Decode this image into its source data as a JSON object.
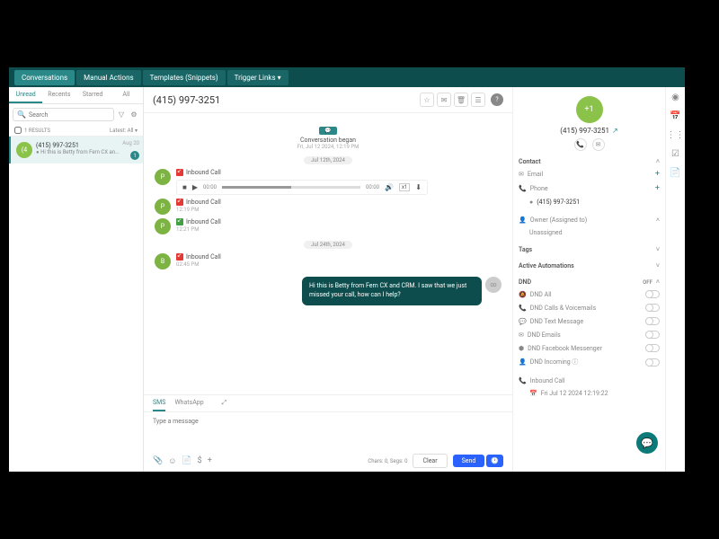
{
  "topnav": {
    "tabs": [
      "Conversations",
      "Manual Actions",
      "Templates (Snippets)",
      "Trigger Links ▾"
    ],
    "active": 0
  },
  "subtabs": {
    "items": [
      "Unread",
      "Recents",
      "Starred",
      "All"
    ],
    "active": 0
  },
  "search": {
    "placeholder": "Search"
  },
  "filter": {
    "results": "1 RESULTS",
    "latest": "Latest: All ▾"
  },
  "convlist": [
    {
      "avatar": "(4",
      "num": "(415) 997-3251",
      "preview": "● Hi this is Betty from Fern CX an...",
      "date": "Aug 20",
      "badge": "1"
    }
  ],
  "header": {
    "title": "(415) 997-3251"
  },
  "thread": {
    "conv_began": "Conversation began",
    "conv_began_ts": "Fri, Jul 12 2024, 12:19 PM",
    "date1": "Jul 12th, 2024",
    "calls": [
      {
        "label": "Inbound Call",
        "time": "12:19 PM",
        "type": "missed",
        "player": true
      },
      {
        "label": "Inbound Call",
        "time": "12:19 PM",
        "type": "missed"
      },
      {
        "label": "Inbound Call",
        "time": "12:21 PM",
        "type": "answered"
      }
    ],
    "date2": "Jul 24th, 2024",
    "calls2": [
      {
        "label": "Inbound Call",
        "time": "02:45 PM",
        "type": "missed"
      }
    ],
    "player": {
      "cur": "00:00",
      "dur": "00:00"
    },
    "outgoing": "Hi this is Betty from Fern CX and CRM. I saw that we just missed your call, how can I help?"
  },
  "composer": {
    "tabs": [
      "SMS",
      "WhatsApp"
    ],
    "active": 0,
    "placeholder": "Type a message",
    "meta": "Chars: 0, Segs: 0",
    "clear": "Clear",
    "send": "Send"
  },
  "contact": {
    "avatar": "+1",
    "num": "(415) 997-3251",
    "sections": {
      "contact": "Contact",
      "email": "Email",
      "phone": "Phone",
      "phone_val": "(415) 997-3251",
      "owner": "Owner (Assigned to)",
      "owner_val": "Unassigned",
      "tags": "Tags",
      "automations": "Active Automations",
      "dnd": "DND",
      "dnd_off": "OFF",
      "dnd_items": [
        "DND All",
        "DND Calls & Voicemails",
        "DND Text Message",
        "DND Emails",
        "DND Facebook Messenger",
        "DND Incoming ⓘ"
      ],
      "activity_call": "Inbound Call",
      "activity_ts": "Fri Jul 12 2024 12:19:22"
    }
  }
}
